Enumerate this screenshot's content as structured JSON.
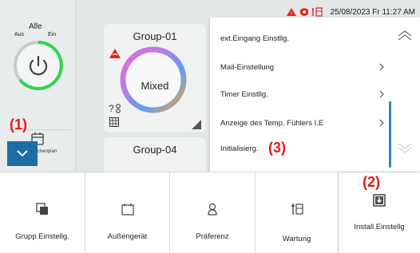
{
  "status_bar": {
    "datetime": "25/08/2023 Fr 11:27 AM",
    "icons": [
      "alarm-icon",
      "filter-icon",
      "maintenance-icon"
    ]
  },
  "all_control": {
    "label": "Alle",
    "off_label": "Aus",
    "on_label": "Ein",
    "state": "on"
  },
  "left_panel": {
    "program_label": "Wochenplan"
  },
  "annotations": {
    "a1": "(1)",
    "a2": "(2)",
    "a3": "(3)"
  },
  "groups": [
    {
      "title": "Group-01",
      "mode": "Mixed"
    },
    {
      "title": "Group-04"
    }
  ],
  "settings_menu": {
    "items": [
      {
        "label": "ext.Eingang Einstllg.",
        "has_arrow": false
      },
      {
        "label": "Mail-Einstellung",
        "has_arrow": true
      },
      {
        "label": "Timer Einstllg.",
        "has_arrow": true
      },
      {
        "label": "Anzeige des Temp. Fühlers I.E",
        "has_arrow": true
      },
      {
        "label": "Initialisierg.",
        "has_arrow": false
      }
    ]
  },
  "bottom_nav": {
    "items": [
      {
        "label": "Grupp.Einstellg.",
        "icon": "group-icon"
      },
      {
        "label": "Außengerät",
        "icon": "outdoor-unit-icon"
      },
      {
        "label": "Präferenz",
        "icon": "user-icon"
      },
      {
        "label": "Wartung",
        "icon": "maintenance-icon"
      },
      {
        "label": "Install.Einstellg",
        "icon": "install-download-icon"
      }
    ]
  },
  "colors": {
    "accent_blue": "#1c6ea4",
    "power_green": "#2fd64a",
    "annotation_red": "#e31b1b",
    "alarm_red": "#e02424"
  }
}
